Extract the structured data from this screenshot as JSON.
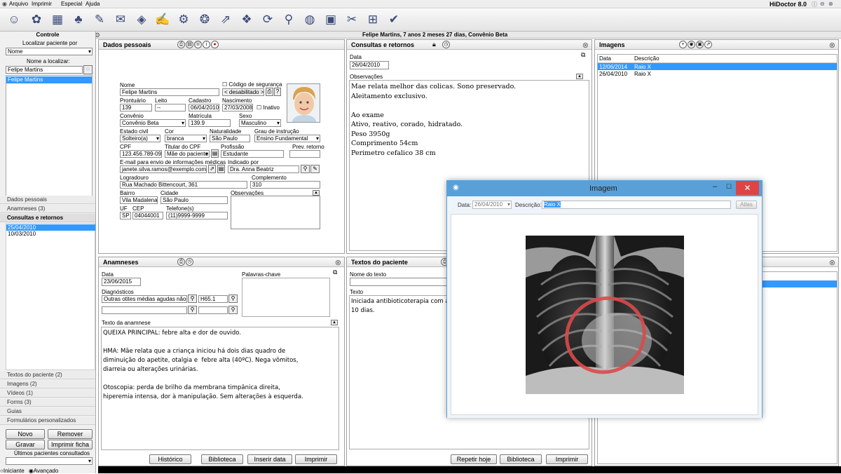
{
  "menu": {
    "items": [
      "Arquivo",
      "Imprimir",
      "Especial",
      "Ajuda"
    ],
    "app_title": "HiDoctor 8.0"
  },
  "patient_header": "Felipe Martins, 7 anos 2 meses 27 dias, Convênio Beta",
  "left": {
    "controle": "Controle",
    "localizar_label": "Localizar paciente por",
    "localizar_value": "Nome",
    "nome_label": "Nome a localizar:",
    "nome_value": "Felipe Martins",
    "result": "Felipe Martins",
    "nav_top": [
      "Dados pessoais",
      "Anamneses  (3)"
    ],
    "consultas_header": "Consultas e retornos",
    "consultas_dates": [
      "25/04/2010",
      "10/03/2010"
    ],
    "nav_bottom": [
      "Textos do paciente  (2)",
      "Imagens  (2)",
      "Vídeos  (1)",
      "Forms  (3)",
      "Guias",
      "Formulários personalizados"
    ],
    "btn_novo": "Novo",
    "btn_remover": "Remover",
    "btn_gravar": "Gravar",
    "btn_imprimir": "Imprimir ficha",
    "ultimos": "Últimos pacientes consultados",
    "radio_iniciante": "Iniciante",
    "radio_avancado": "Avançado"
  },
  "dados": {
    "title": "Dados pessoais",
    "nome_l": "Nome",
    "nome": "Felipe Martins",
    "codigo_l": "Código de segurança",
    "codigo": "< desabilitado >",
    "prontuario_l": "Prontuário",
    "prontuario": "139",
    "leito_l": "Leito",
    "leito": "--",
    "cadastro_l": "Cadastro",
    "cadastro": "06/04/2010",
    "nascimento_l": "Nascimento",
    "nascimento": "27/03/2008",
    "inativo": "Inativo",
    "convenio_l": "Convênio",
    "convenio": "Convênio Beta",
    "matricula_l": "Matrícula",
    "matricula": "139.9",
    "sexo_l": "Sexo",
    "sexo": "Masculino",
    "estado_l": "Estado civil",
    "estado": "Solteiro(a)",
    "cor_l": "Cor",
    "cor": "branca",
    "natural_l": "Naturalidade",
    "natural": "São Paulo",
    "grau_l": "Grau de instrução",
    "grau": "Ensino Fundamental",
    "cpf_l": "CPF",
    "cpf": "123.456.789-09",
    "titular_l": "Titular do CPF",
    "titular": "Mãe do paciente",
    "profissao_l": "Profissão",
    "profissao": "Estudante",
    "prev_l": "Prev. retorno",
    "email_l": "E-mail para envio de informações médicas",
    "email": "janete.silva.ramos@exemplo.com",
    "indicado_l": "Indicado por",
    "indicado": "Dra. Anna Beatriz",
    "logradouro_l": "Logradouro",
    "logradouro": "Rua Machado Bittencourt, 361",
    "complemento_l": "Complemento",
    "complemento": "310",
    "bairro_l": "Bairro",
    "bairro": "Vila Madalena",
    "cidade_l": "Cidade",
    "cidade": "São Paulo",
    "obs_l": "Observações",
    "uf_l": "UF",
    "uf": "SP",
    "cep_l": "CEP",
    "cep": "04044001",
    "tel_l": "Telefone(s)",
    "tel": "(11)9999-9999"
  },
  "consultas": {
    "title": "Consultas e retornos",
    "data_l": "Data",
    "data": "26/04/2010",
    "obs_l": "Observações",
    "text": "Mae relata melhor das colicas. Sono preservado.\nAleitamento exclusivo.\n\nAo exame\nAtivo, reativo, corado, hidratado.\nPeso 3950g\nComprimento 54cm\nPerimetro cefalico 38 cm",
    "btn_repetir": "Repetir hoje",
    "btn_biblioteca": "Biblioteca",
    "btn_imprimir": "Imprimir"
  },
  "imagens": {
    "title": "Imagens",
    "col_data": "Data",
    "col_desc": "Descrição",
    "rows": [
      {
        "data": "12/06/2014",
        "desc": "Raio X"
      },
      {
        "data": "26/04/2010",
        "desc": "Raio X"
      }
    ]
  },
  "anamneses": {
    "title": "Anamneses",
    "data_l": "Data",
    "data": "23/06/2015",
    "palavras_l": "Palavras-chave",
    "diag_l": "Diagnósticos",
    "diag": "Outras otites médias agudas não-sup",
    "cid": "H65.1",
    "texto_l": "Texto da anamnese",
    "text": "QUEIXA PRINCIPAL: febre alta e dor de ouvido.\n\nHMA: Mãe relata que a criança iniciou há dois dias quadro de\ndiminuição do apetite, otalgia e  febre alta (40ºC). Nega vômitos,\ndiarreia ou alterações urinárias.\n\nOtoscopia: perda de brilho da membrana timpânica direita,\nhiperemia intensa, dor à manipulação. Sem alterações à esquerda.",
    "btn_hist": "Histórico",
    "btn_bib": "Biblioteca",
    "btn_ins": "Inserir data",
    "btn_imp": "Imprimir"
  },
  "textos": {
    "title": "Textos do paciente",
    "nome_l": "Nome do texto",
    "texto_l": "Texto",
    "text": "Iniciada antibioticoterapia com a\n10 dias."
  },
  "modal": {
    "title": "Imagem",
    "data_l": "Data:",
    "data": "26/04/2010",
    "desc_l": "Descrição:",
    "desc": "Raio X",
    "btn": "Atlas"
  },
  "colors": {
    "select": "#3399ff",
    "modal_border": "#5aa0d8",
    "close_red": "#e04343"
  }
}
